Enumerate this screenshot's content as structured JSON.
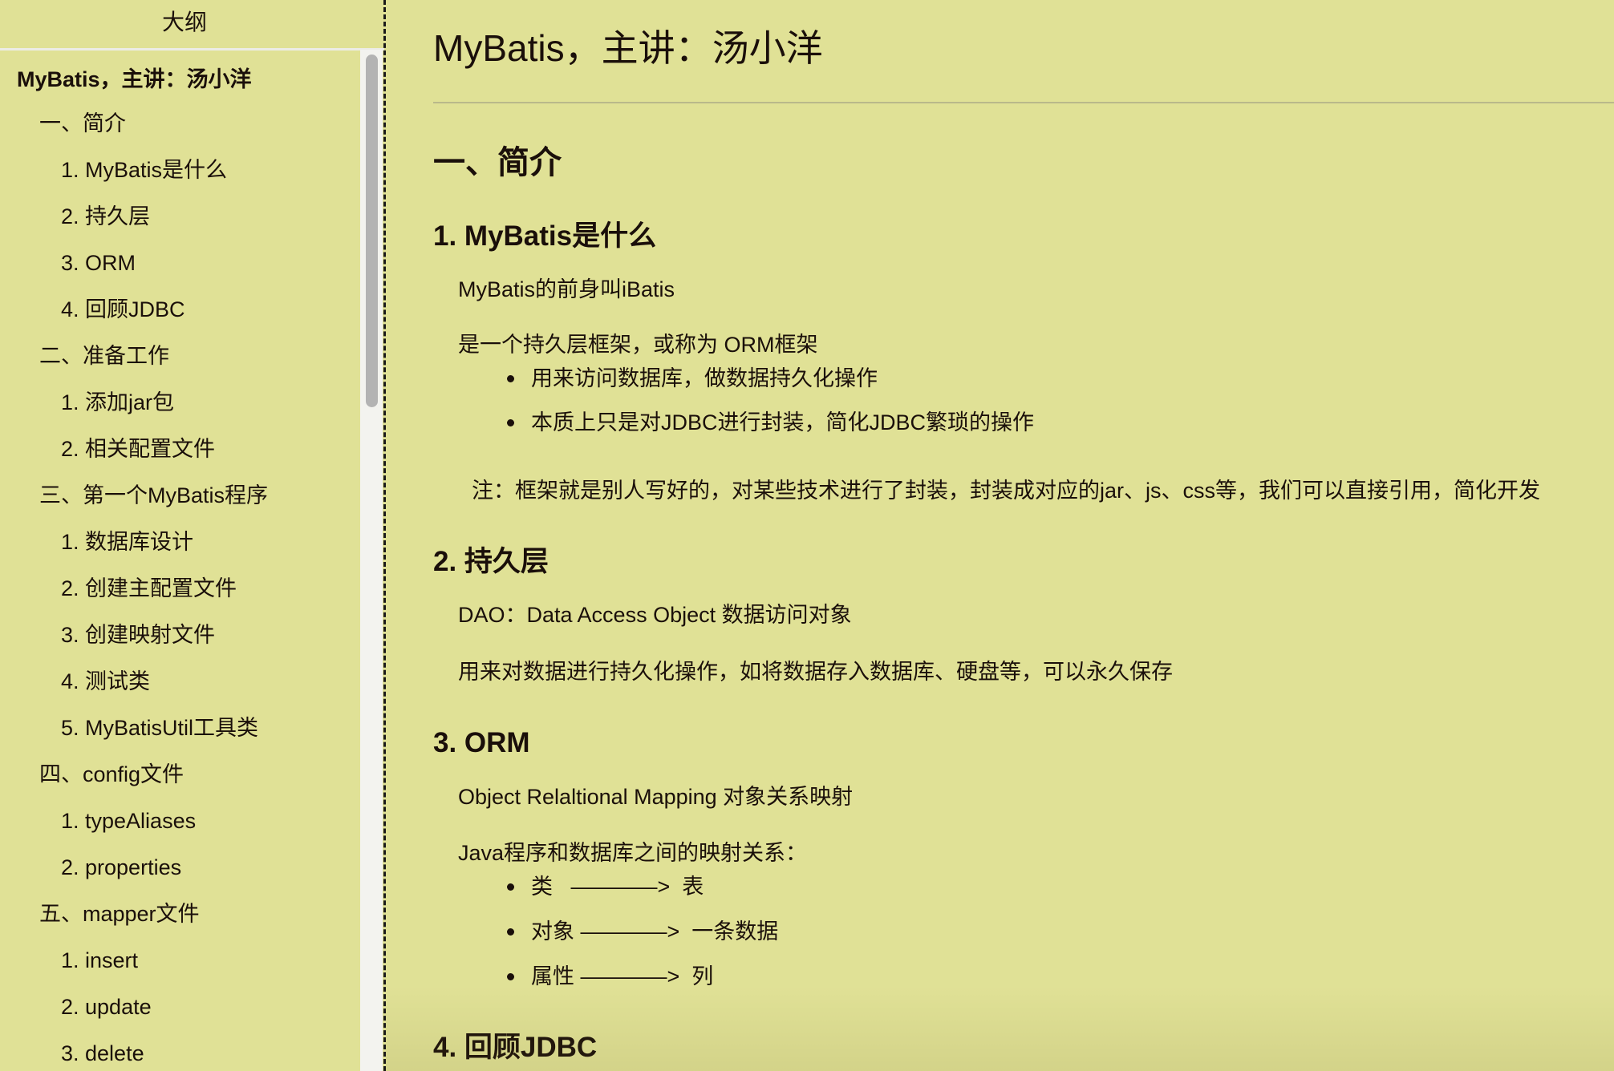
{
  "sidebar": {
    "header": "大纲",
    "items": [
      {
        "label": "MyBatis，主讲：汤小洋",
        "level": 0
      },
      {
        "label": "一、简介",
        "level": 1
      },
      {
        "label": "1. MyBatis是什么",
        "level": 2
      },
      {
        "label": "2. 持久层",
        "level": 2
      },
      {
        "label": "3. ORM",
        "level": 2
      },
      {
        "label": "4. 回顾JDBC",
        "level": 2
      },
      {
        "label": "二、准备工作",
        "level": 1
      },
      {
        "label": "1. 添加jar包",
        "level": 2
      },
      {
        "label": "2. 相关配置文件",
        "level": 2
      },
      {
        "label": "三、第一个MyBatis程序",
        "level": 1
      },
      {
        "label": "1. 数据库设计",
        "level": 2
      },
      {
        "label": "2. 创建主配置文件",
        "level": 2
      },
      {
        "label": "3. 创建映射文件",
        "level": 2
      },
      {
        "label": "4. 测试类",
        "level": 2
      },
      {
        "label": "5. MyBatisUtil工具类",
        "level": 2
      },
      {
        "label": "四、config文件",
        "level": 1
      },
      {
        "label": "1. typeAliases",
        "level": 2
      },
      {
        "label": "2. properties",
        "level": 2
      },
      {
        "label": "五、mapper文件",
        "level": 1
      },
      {
        "label": "1. insert",
        "level": 2
      },
      {
        "label": "2. update",
        "level": 2
      },
      {
        "label": "3. delete",
        "level": 2
      }
    ]
  },
  "doc": {
    "title": "MyBatis，主讲：汤小洋",
    "section1": "一、简介",
    "s1_1": {
      "heading": "1. MyBatis是什么",
      "p1": "MyBatis的前身叫iBatis",
      "p2": "是一个持久层框架，或称为 ORM框架",
      "bullets": [
        "用来访问数据库，做数据持久化操作",
        "本质上只是对JDBC进行封装，简化JDBC繁琐的操作"
      ],
      "note": "注：框架就是别人写好的，对某些技术进行了封装，封装成对应的jar、js、css等，我们可以直接引用，简化开发"
    },
    "s1_2": {
      "heading": "2. 持久层",
      "p1": "DAO：Data Access Object 数据访问对象",
      "p2": "用来对数据进行持久化操作，如将数据存入数据库、硬盘等，可以永久保存"
    },
    "s1_3": {
      "heading": "3. ORM",
      "p1": "Object Relaltional Mapping 对象关系映射",
      "p2": "Java程序和数据库之间的映射关系：",
      "bullets": [
        "类   ————>  表",
        "对象 ————>  一条数据",
        "属性 ————>  列"
      ]
    },
    "s1_4": {
      "heading": "4. 回顾JDBC"
    }
  }
}
